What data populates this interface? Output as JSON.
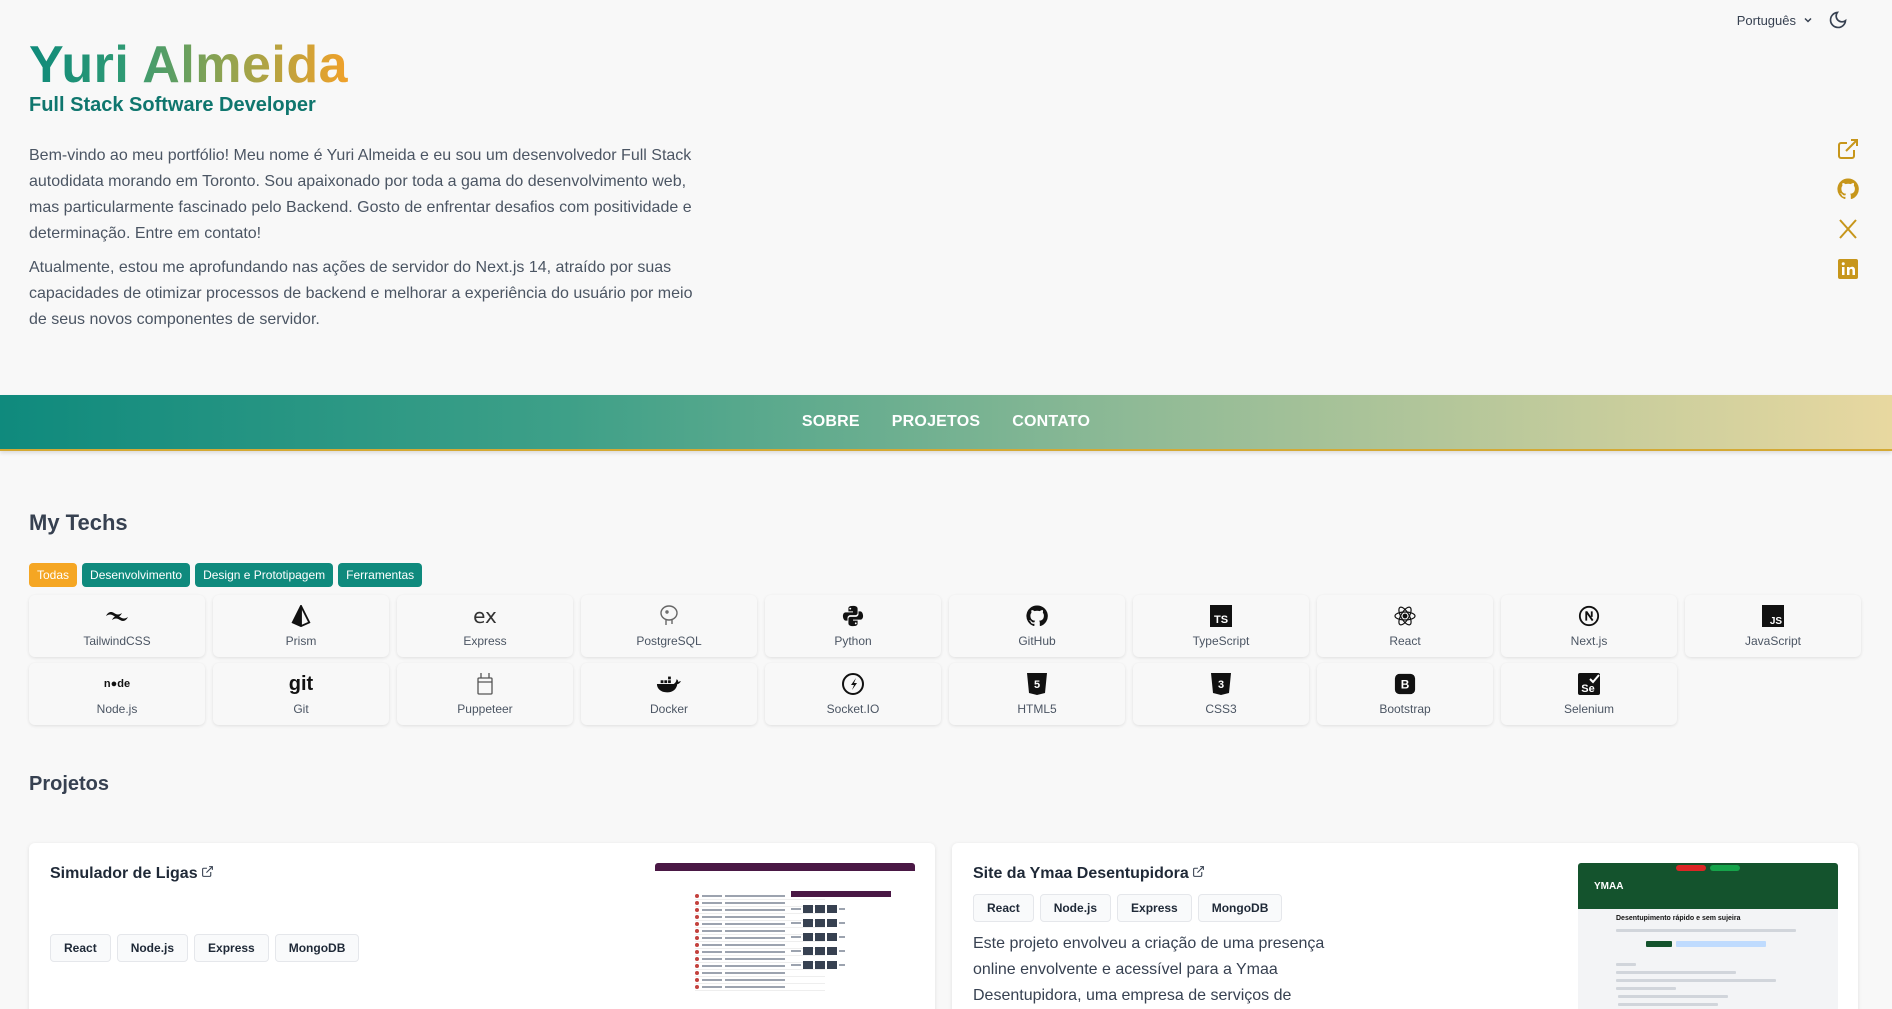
{
  "header": {
    "language": "Português",
    "theme_icon": "moon-icon"
  },
  "hero": {
    "name": "Yuri Almeida",
    "role": "Full Stack Software Developer",
    "bio": [
      "Bem-vindo ao meu portfólio! Meu nome é Yuri Almeida e eu sou um desenvolvedor Full Stack autodidata morando em Toronto. Sou apaixonado por toda a gama do desenvolvimento web, mas particularmente fascinado pelo Backend. Gosto de enfrentar desafios com positividade e determinação. Entre em contato!",
      "Atualmente, estou me aprofundando nas ações de servidor do Next.js 14, atraído por suas capacidades de otimizar processos de backend e melhorar a experiência do usuário por meio de seus novos componentes de servidor."
    ],
    "socials": [
      "external-link-icon",
      "github-icon",
      "x-icon",
      "linkedin-icon"
    ]
  },
  "nav": {
    "items": [
      "SOBRE",
      "PROJETOS",
      "CONTATO"
    ]
  },
  "techs": {
    "title": "My Techs",
    "filters": [
      "Todas",
      "Desenvolvimento",
      "Design e Prototipagem",
      "Ferramentas"
    ],
    "active_filter": "Todas",
    "items": [
      {
        "label": "TailwindCSS",
        "icon": "tailwind-icon"
      },
      {
        "label": "Prism",
        "icon": "prism-icon"
      },
      {
        "label": "Express",
        "icon": "express-icon"
      },
      {
        "label": "PostgreSQL",
        "icon": "postgresql-icon"
      },
      {
        "label": "Python",
        "icon": "python-icon"
      },
      {
        "label": "GitHub",
        "icon": "github-icon"
      },
      {
        "label": "TypeScript",
        "icon": "typescript-icon"
      },
      {
        "label": "React",
        "icon": "react-icon"
      },
      {
        "label": "Next.js",
        "icon": "nextjs-icon"
      },
      {
        "label": "JavaScript",
        "icon": "javascript-icon"
      },
      {
        "label": "Node.js",
        "icon": "nodejs-icon"
      },
      {
        "label": "Git",
        "icon": "git-icon"
      },
      {
        "label": "Puppeteer",
        "icon": "puppeteer-icon"
      },
      {
        "label": "Docker",
        "icon": "docker-icon"
      },
      {
        "label": "Socket.IO",
        "icon": "socketio-icon"
      },
      {
        "label": "HTML5",
        "icon": "html5-icon"
      },
      {
        "label": "CSS3",
        "icon": "css3-icon"
      },
      {
        "label": "Bootstrap",
        "icon": "bootstrap-icon"
      },
      {
        "label": "Selenium",
        "icon": "selenium-icon"
      }
    ]
  },
  "projects": {
    "title": "Projetos",
    "items": [
      {
        "title": "Simulador de Ligas",
        "tags": [
          "React",
          "Node.js",
          "Express",
          "MongoDB"
        ],
        "description": ""
      },
      {
        "title": "Site da Ymaa Desentupidora",
        "tags": [
          "React",
          "Node.js",
          "Express",
          "MongoDB"
        ],
        "description": "Este projeto envolveu a criação de uma presença online envolvente e acessível para a Ymaa Desentupidora, uma empresa de serviços de"
      }
    ],
    "thumb2_logo": "YMAA",
    "thumb2_heading": "Desentupimento rápido e sem sujeira"
  },
  "colors": {
    "brand_teal": "#0f8a7d",
    "accent_orange": "#f5a623",
    "social_gold": "#c7961b"
  }
}
